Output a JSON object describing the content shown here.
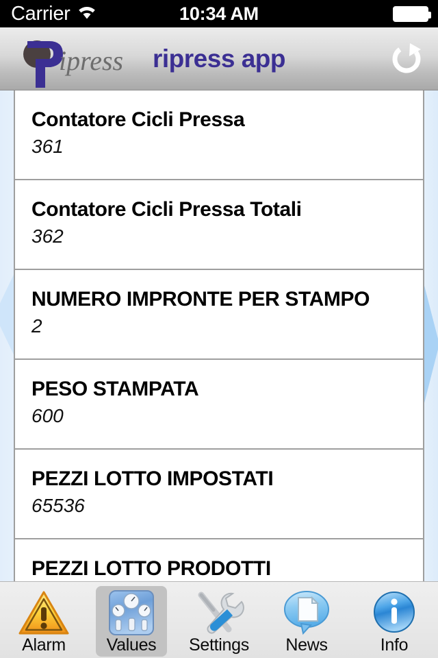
{
  "status_bar": {
    "carrier": "Carrier",
    "wifi_icon": "wifi-icon",
    "time": "10:34 AM",
    "battery_icon": "battery-full-icon"
  },
  "nav_bar": {
    "logo_icon": "ripress-logo-icon",
    "logo_text": "ipress",
    "title": "ripress app",
    "title_color": "#3b2f93",
    "refresh_icon": "refresh-icon"
  },
  "content": {
    "background_color": "#ffffff",
    "side_panel_color": "#dbeaf8",
    "left_chevron_icon": "chevron-left-icon",
    "right_chevron_icon": "chevron-right-icon",
    "rows": [
      {
        "title": "Contatore Cicli Pressa",
        "value": "361"
      },
      {
        "title": "Contatore Cicli Pressa Totali",
        "value": "362"
      },
      {
        "title": "NUMERO IMPRONTE PER STAMPO",
        "value": "2"
      },
      {
        "title": "PESO STAMPATA",
        "value": "600"
      },
      {
        "title": "PEZZI LOTTO IMPOSTATI",
        "value": "65536"
      },
      {
        "title": "PEZZI LOTTO PRODOTTI",
        "value": ""
      }
    ]
  },
  "tab_bar": {
    "selected": "Values",
    "tabs": [
      {
        "label": "Alarm",
        "icon": "warning-triangle-icon"
      },
      {
        "label": "Values",
        "icon": "gauges-panel-icon"
      },
      {
        "label": "Settings",
        "icon": "tools-wrench-screwdriver-icon"
      },
      {
        "label": "News",
        "icon": "speech-bubble-document-icon"
      },
      {
        "label": "Info",
        "icon": "info-circle-icon"
      }
    ]
  }
}
